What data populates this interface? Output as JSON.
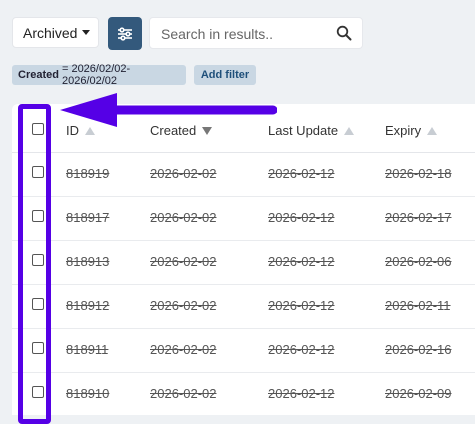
{
  "toolbar": {
    "archived_label": "Archived",
    "search_placeholder": "Search in results.."
  },
  "filters": {
    "created_key": "Created",
    "created_value": "= 2026/02/02-2026/02/02",
    "add_filter_label": "Add filter"
  },
  "table": {
    "headers": {
      "id": "ID",
      "created": "Created",
      "last_update": "Last Update",
      "expiry": "Expiry"
    },
    "sort": {
      "column": "Created",
      "direction": "descending"
    },
    "rows": [
      {
        "id": "818919",
        "created": "2026-02-02",
        "last_update": "2026-02-12",
        "expiry": "2026-02-18"
      },
      {
        "id": "818917",
        "created": "2026-02-02",
        "last_update": "2026-02-12",
        "expiry": "2026-02-17"
      },
      {
        "id": "818913",
        "created": "2026-02-02",
        "last_update": "2026-02-12",
        "expiry": "2026-02-06"
      },
      {
        "id": "818912",
        "created": "2026-02-02",
        "last_update": "2026-02-12",
        "expiry": "2026-02-11"
      },
      {
        "id": "818911",
        "created": "2026-02-02",
        "last_update": "2026-02-12",
        "expiry": "2026-02-16"
      },
      {
        "id": "818910",
        "created": "2026-02-02",
        "last_update": "2026-02-12",
        "expiry": "2026-02-09"
      }
    ]
  },
  "icons": {
    "filter": "sliders-icon",
    "search": "search-icon",
    "dropdown": "caret-down-icon"
  },
  "colors": {
    "accent": "#33597c",
    "chip": "#c9d7e3",
    "annotation": "#5500e6",
    "background": "#eef1f4"
  }
}
